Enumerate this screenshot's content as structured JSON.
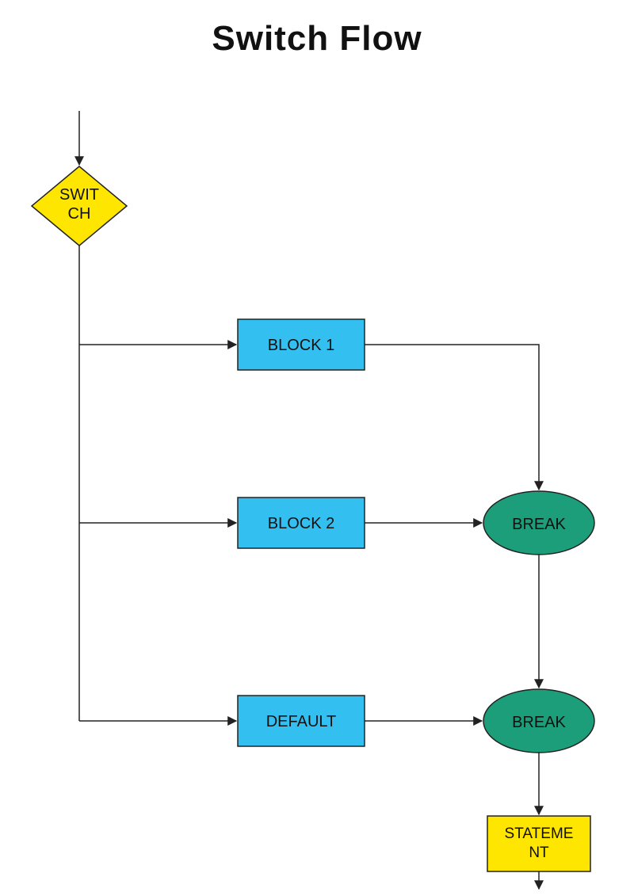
{
  "title": "Switch Flow",
  "nodes": {
    "switch": {
      "label": "SWITCH",
      "line1": "SWIT",
      "line2": "CH"
    },
    "block1": {
      "label": "BLOCK 1"
    },
    "block2": {
      "label": "BLOCK 2"
    },
    "default": {
      "label": "DEFAULT"
    },
    "break1": {
      "label": "BREAK"
    },
    "break2": {
      "label": "BREAK"
    },
    "statement": {
      "label": "STATEMENT",
      "line1": "STATEME",
      "line2": "NT"
    }
  },
  "colors": {
    "yellow": "#ffe600",
    "cyan": "#33bff0",
    "teal": "#1d9e7a",
    "stroke": "#222222"
  }
}
